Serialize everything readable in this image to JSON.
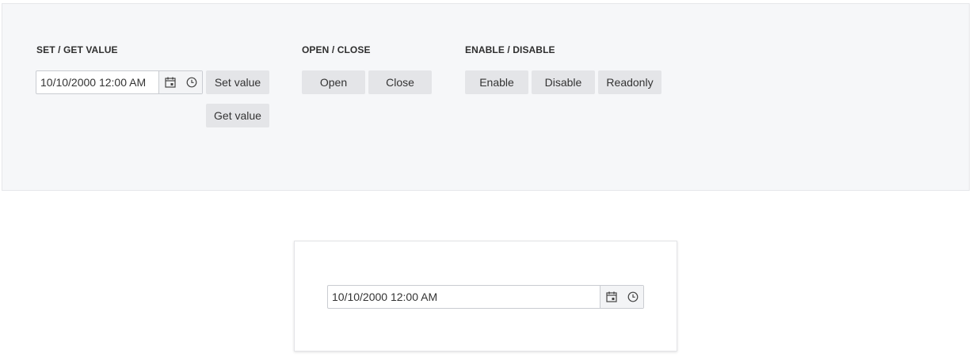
{
  "config": {
    "set_get": {
      "title": "SET / GET VALUE",
      "input_value": "10/10/2000 12:00 AM",
      "set_value_label": "Set value",
      "get_value_label": "Get value"
    },
    "open_close": {
      "title": "OPEN / CLOSE",
      "open_label": "Open",
      "close_label": "Close"
    },
    "enable_disable": {
      "title": "ENABLE / DISABLE",
      "enable_label": "Enable",
      "disable_label": "Disable",
      "readonly_label": "Readonly"
    }
  },
  "demo": {
    "picker_value": "10/10/2000 12:00 AM"
  },
  "icons": {
    "date": "calendar-icon",
    "time": "clock-icon"
  },
  "colors": {
    "panel_bg": "#f6f7f9",
    "button_bg": "#e4e5e8",
    "input_border": "#c9ccd1"
  }
}
